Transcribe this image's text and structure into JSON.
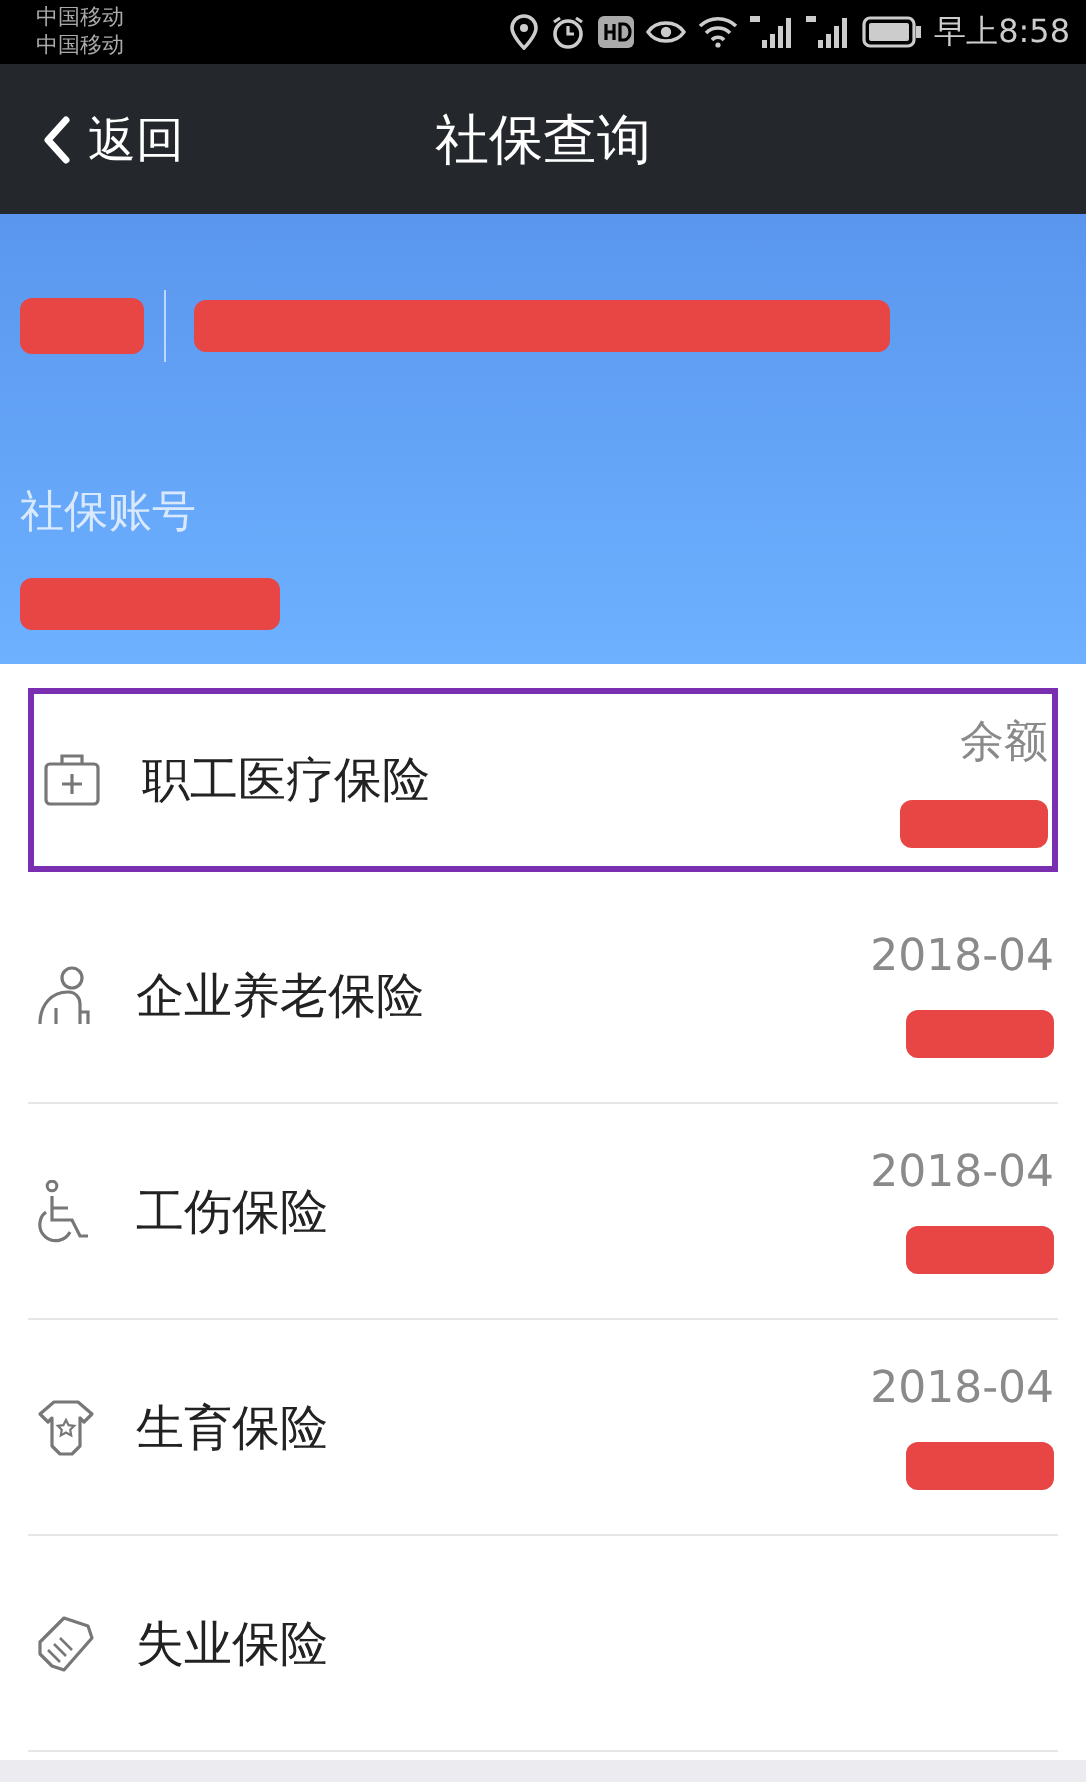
{
  "status_bar": {
    "carriers": [
      "中国移动",
      "中国移动"
    ],
    "time": "早上8:58"
  },
  "nav": {
    "back": "返回",
    "title": "社保查询"
  },
  "header": {
    "name_redacted": true,
    "id_redacted": true,
    "account_label": "社保账号",
    "account_redacted": true
  },
  "items": [
    {
      "kind": "medical",
      "name": "职工医疗保险",
      "meta": "余额",
      "value_redacted": true,
      "selected": true
    },
    {
      "kind": "pension",
      "name": "企业养老保险",
      "meta": "2018-04",
      "value_redacted": true,
      "selected": false
    },
    {
      "kind": "injury",
      "name": "工伤保险",
      "meta": "2018-04",
      "value_redacted": true,
      "selected": false
    },
    {
      "kind": "maternity",
      "name": "生育保险",
      "meta": "2018-04",
      "value_redacted": true,
      "selected": false
    },
    {
      "kind": "unemployment",
      "name": "失业保险",
      "selected": false
    }
  ]
}
